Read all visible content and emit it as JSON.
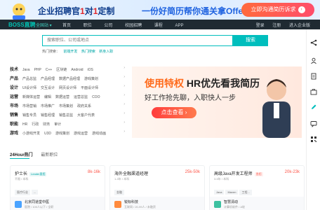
{
  "banner": {
    "headline_a": "企业招聘官",
    "headline_num": "1",
    "headline_b": "对",
    "headline_num2": "1",
    "headline_c": "定制",
    "middle": "一份好简历帮你通关拿Offer",
    "cta": "立即沟通简历诉求"
  },
  "nav": {
    "logo": "BOSS直聘",
    "city": "全国站",
    "links": [
      "首页",
      "职位",
      "公司",
      "校园招聘",
      "课程",
      "APP"
    ],
    "right": [
      "登录",
      "注册",
      "进入企业版"
    ]
  },
  "search": {
    "placeholder": "搜索职位、公司或地点",
    "button": "搜索",
    "hot_label": "热门搜索：",
    "hot_items": [
      "前端开发",
      "热门搜索",
      "新身入职"
    ]
  },
  "categories": [
    {
      "name": "技术",
      "items": [
        "Java",
        "PHP",
        "C++",
        "区块链",
        "Android",
        "iOS"
      ]
    },
    {
      "name": "产品",
      "items": [
        "产品总监",
        "产品经理",
        "数据产品经理",
        "游戏策划"
      ]
    },
    {
      "name": "设计",
      "items": [
        "UI设计师",
        "交互设计",
        "网页设计师",
        "平面设计师"
      ]
    },
    {
      "name": "运营",
      "items": [
        "新媒体运营",
        "编辑",
        "数据运营",
        "运营总监",
        "COO"
      ]
    },
    {
      "name": "市场",
      "items": [
        "市场营销",
        "市场推广",
        "市场策划",
        "政府关系"
      ]
    },
    {
      "name": "销售",
      "items": [
        "销售专员",
        "销售经理",
        "销售总监",
        "大客户代表"
      ]
    },
    {
      "name": "职能",
      "items": [
        "HR",
        "行政",
        "财务",
        "审计"
      ]
    },
    {
      "name": "游戏",
      "items": [
        "小游戏开发",
        "U3D",
        "游戏策划",
        "游戏运营",
        "游戏动画"
      ]
    }
  ],
  "promo": {
    "line1_a": "使用特权",
    "line1_b": "HR优先看我简历",
    "line2": "好工作抢先聊，入职快人一步",
    "button": "点击查看"
  },
  "tabs": [
    "24Hour热门",
    "最新职位"
  ],
  "jobs": [
    {
      "title": "护士长",
      "tag": "Leader直招",
      "salary": "8k-16k",
      "meta": "不限 / 本科",
      "chips": [
        "医疗行业",
        "..."
      ],
      "company": "北京同道堂中医",
      "company_meta": "医院 / 100人以下 / 全职"
    },
    {
      "title": "海外全融渠道经理",
      "tag": "",
      "salary": "25k-50k",
      "meta": "1-3年 / 本科",
      "chips": [
        "金融"
      ],
      "company": "锐标科技",
      "company_meta": "互联网 / 20-99人 / 未融资"
    },
    {
      "title": "高级Java开发工程师",
      "tag": "急招",
      "salary": "20k-23k",
      "meta": "3-5年 / 本科",
      "chips": [
        "Java",
        "Maven",
        "工程..."
      ],
      "company": "智慧清动",
      "company_meta": "计算机软件 / A轮"
    }
  ],
  "colors": {
    "accent": "#00bebd",
    "salary": "#fe574a",
    "promo": "#ff6a1a"
  }
}
